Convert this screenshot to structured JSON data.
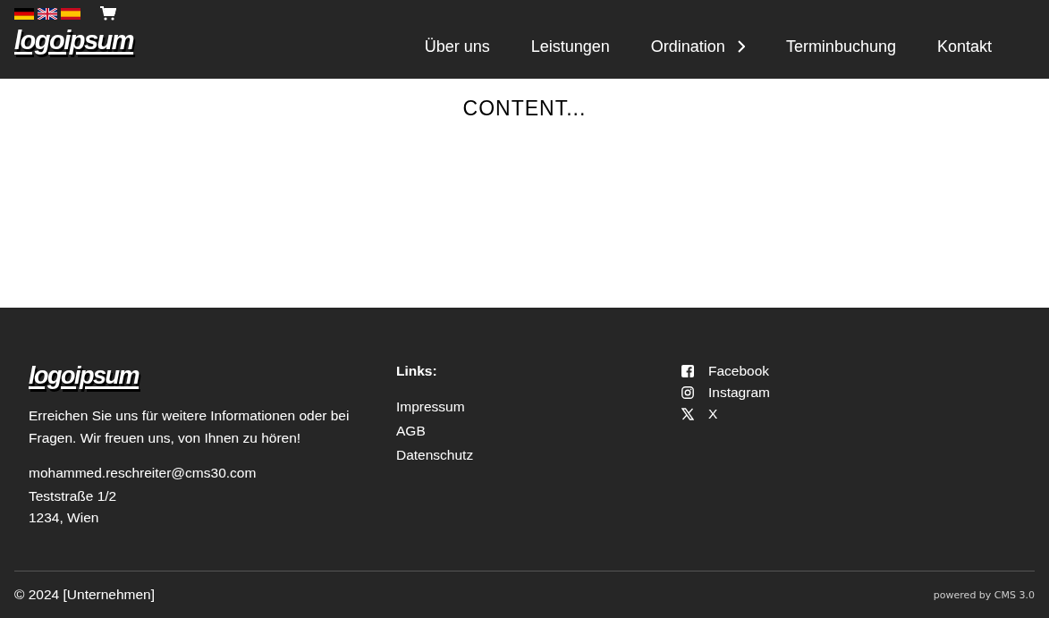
{
  "header": {
    "languages": [
      {
        "kind": "de"
      },
      {
        "kind": "en"
      },
      {
        "kind": "es"
      }
    ],
    "logo": "logoipsum",
    "nav": [
      {
        "label": "Über uns",
        "has_submenu": false
      },
      {
        "label": "Leistungen",
        "has_submenu": false
      },
      {
        "label": "Ordination",
        "has_submenu": true
      },
      {
        "label": "Terminbuchung",
        "has_submenu": false
      },
      {
        "label": "Kontakt",
        "has_submenu": false
      }
    ]
  },
  "content": {
    "text": "CONTENT..."
  },
  "footer": {
    "logo": "logoipsum",
    "description": "Erreichen Sie uns für weitere Informationen oder bei Fragen. Wir freuen uns, von Ihnen zu hören!",
    "email": "mohammed.reschreiter@cms30.com",
    "address": [
      "Teststraße 1/2",
      "1234, Wien"
    ],
    "links_title": "Links:",
    "links": [
      "Impressum",
      "AGB",
      "Datenschutz"
    ],
    "social": [
      {
        "kind": "facebook",
        "label": "Facebook"
      },
      {
        "kind": "instagram",
        "label": "Instagram"
      },
      {
        "kind": "x",
        "label": "X"
      }
    ],
    "copyright": "© 2024 [Unternehmen]",
    "powered_by": "powered by CMS 3.0"
  }
}
